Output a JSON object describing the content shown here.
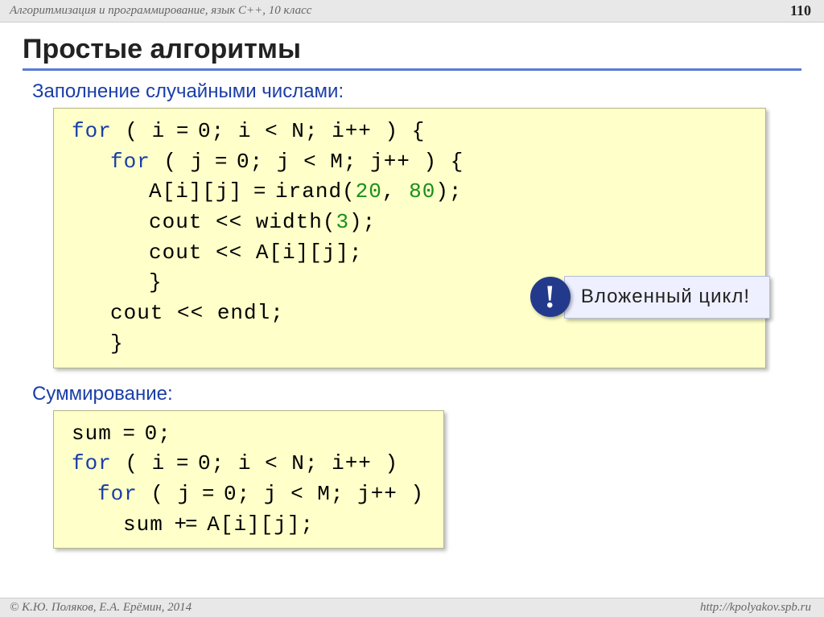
{
  "header": {
    "breadcrumb": "Алгоритмизация и программирование, язык C++, 10 класс",
    "page_number": "110"
  },
  "title": "Простые алгоритмы",
  "section1": {
    "label": "Заполнение случайными числами:",
    "code": {
      "l1_for": "for",
      "l1_rest_a": " ( i",
      "l1_eq": " = ",
      "l1_rest_b": "0; i",
      "l1_lt": " < ",
      "l1_rest_c": "N; i++ ) {",
      "l2_for": "for",
      "l2_rest_a": " ( j",
      "l2_eq": " = ",
      "l2_rest_b": "0; j",
      "l2_lt": " < ",
      "l2_rest_c": "M; j++ ) {",
      "l3_a": "A[i][j]",
      "l3_eq": " = ",
      "l3_b": "irand(",
      "l3_n1": "20",
      "l3_c": ", ",
      "l3_n2": "80",
      "l3_d": ");",
      "l4": "cout << width(",
      "l4_n": "3",
      "l4_b": ");",
      "l5": "cout << A[i][j];",
      "l6": "}",
      "l7": "cout << endl;",
      "l8": "}"
    },
    "callout_text": "Вложенный цикл!"
  },
  "section2": {
    "label": "Суммирование:",
    "code": {
      "l1_a": "sum",
      "l1_eq": " = ",
      "l1_b": "0;",
      "l2_for": "for",
      "l2_rest_a": " ( i",
      "l2_eq": " = ",
      "l2_rest_b": "0; i",
      "l2_lt": " < ",
      "l2_rest_c": "N; i++ )",
      "l3_for": "for",
      "l3_rest_a": " ( j",
      "l3_eq": " = ",
      "l3_rest_b": "0; j",
      "l3_lt": " < ",
      "l3_rest_c": "M; j++ )",
      "l4_a": "sum",
      "l4_op": " += ",
      "l4_b": "A[i][j];"
    }
  },
  "footer": {
    "copyright": "© К.Ю. Поляков, Е.А. Ерёмин, 2014",
    "url": "http://kpolyakov.spb.ru"
  }
}
